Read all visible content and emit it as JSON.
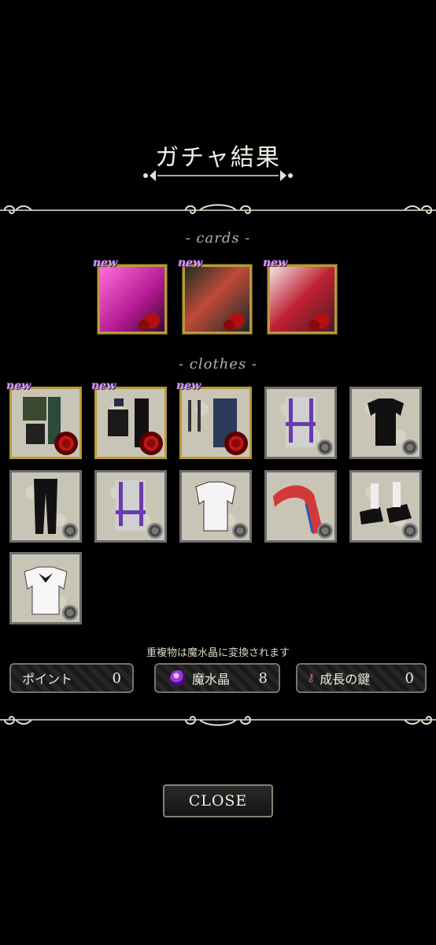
{
  "header": {
    "title": "ガチャ結果"
  },
  "sections": {
    "cards_label": "- cards -",
    "clothes_label": "- clothes -"
  },
  "cards": [
    {
      "new_label": "new",
      "color": "#e04ab8"
    },
    {
      "new_label": "new",
      "color": "#b33a2a"
    },
    {
      "new_label": "new",
      "color": "#c8b0b6"
    }
  ],
  "clothes": [
    {
      "new_label": "new",
      "rarity": "gold"
    },
    {
      "new_label": "new",
      "rarity": "gold"
    },
    {
      "new_label": "new",
      "rarity": "gold"
    },
    {
      "rarity": "silver"
    },
    {
      "rarity": "silver"
    },
    {
      "rarity": "silver"
    },
    {
      "rarity": "silver"
    },
    {
      "rarity": "silver"
    },
    {
      "rarity": "silver"
    },
    {
      "rarity": "silver"
    },
    {
      "rarity": "silver"
    }
  ],
  "note": "重複物は魔水晶に変換されます",
  "stats": {
    "points": {
      "label": "ポイント",
      "value": "0"
    },
    "crystal": {
      "label": "魔水晶",
      "value": "8",
      "icon": "purple-gem-icon"
    },
    "key": {
      "label": "成長の鍵",
      "value": "0",
      "icon": "key-icon"
    }
  },
  "close_button": "CLOSE",
  "colors": {
    "background": "#000000",
    "gold_frame": "#b79a3a",
    "silver_frame": "#6e6e6e"
  }
}
